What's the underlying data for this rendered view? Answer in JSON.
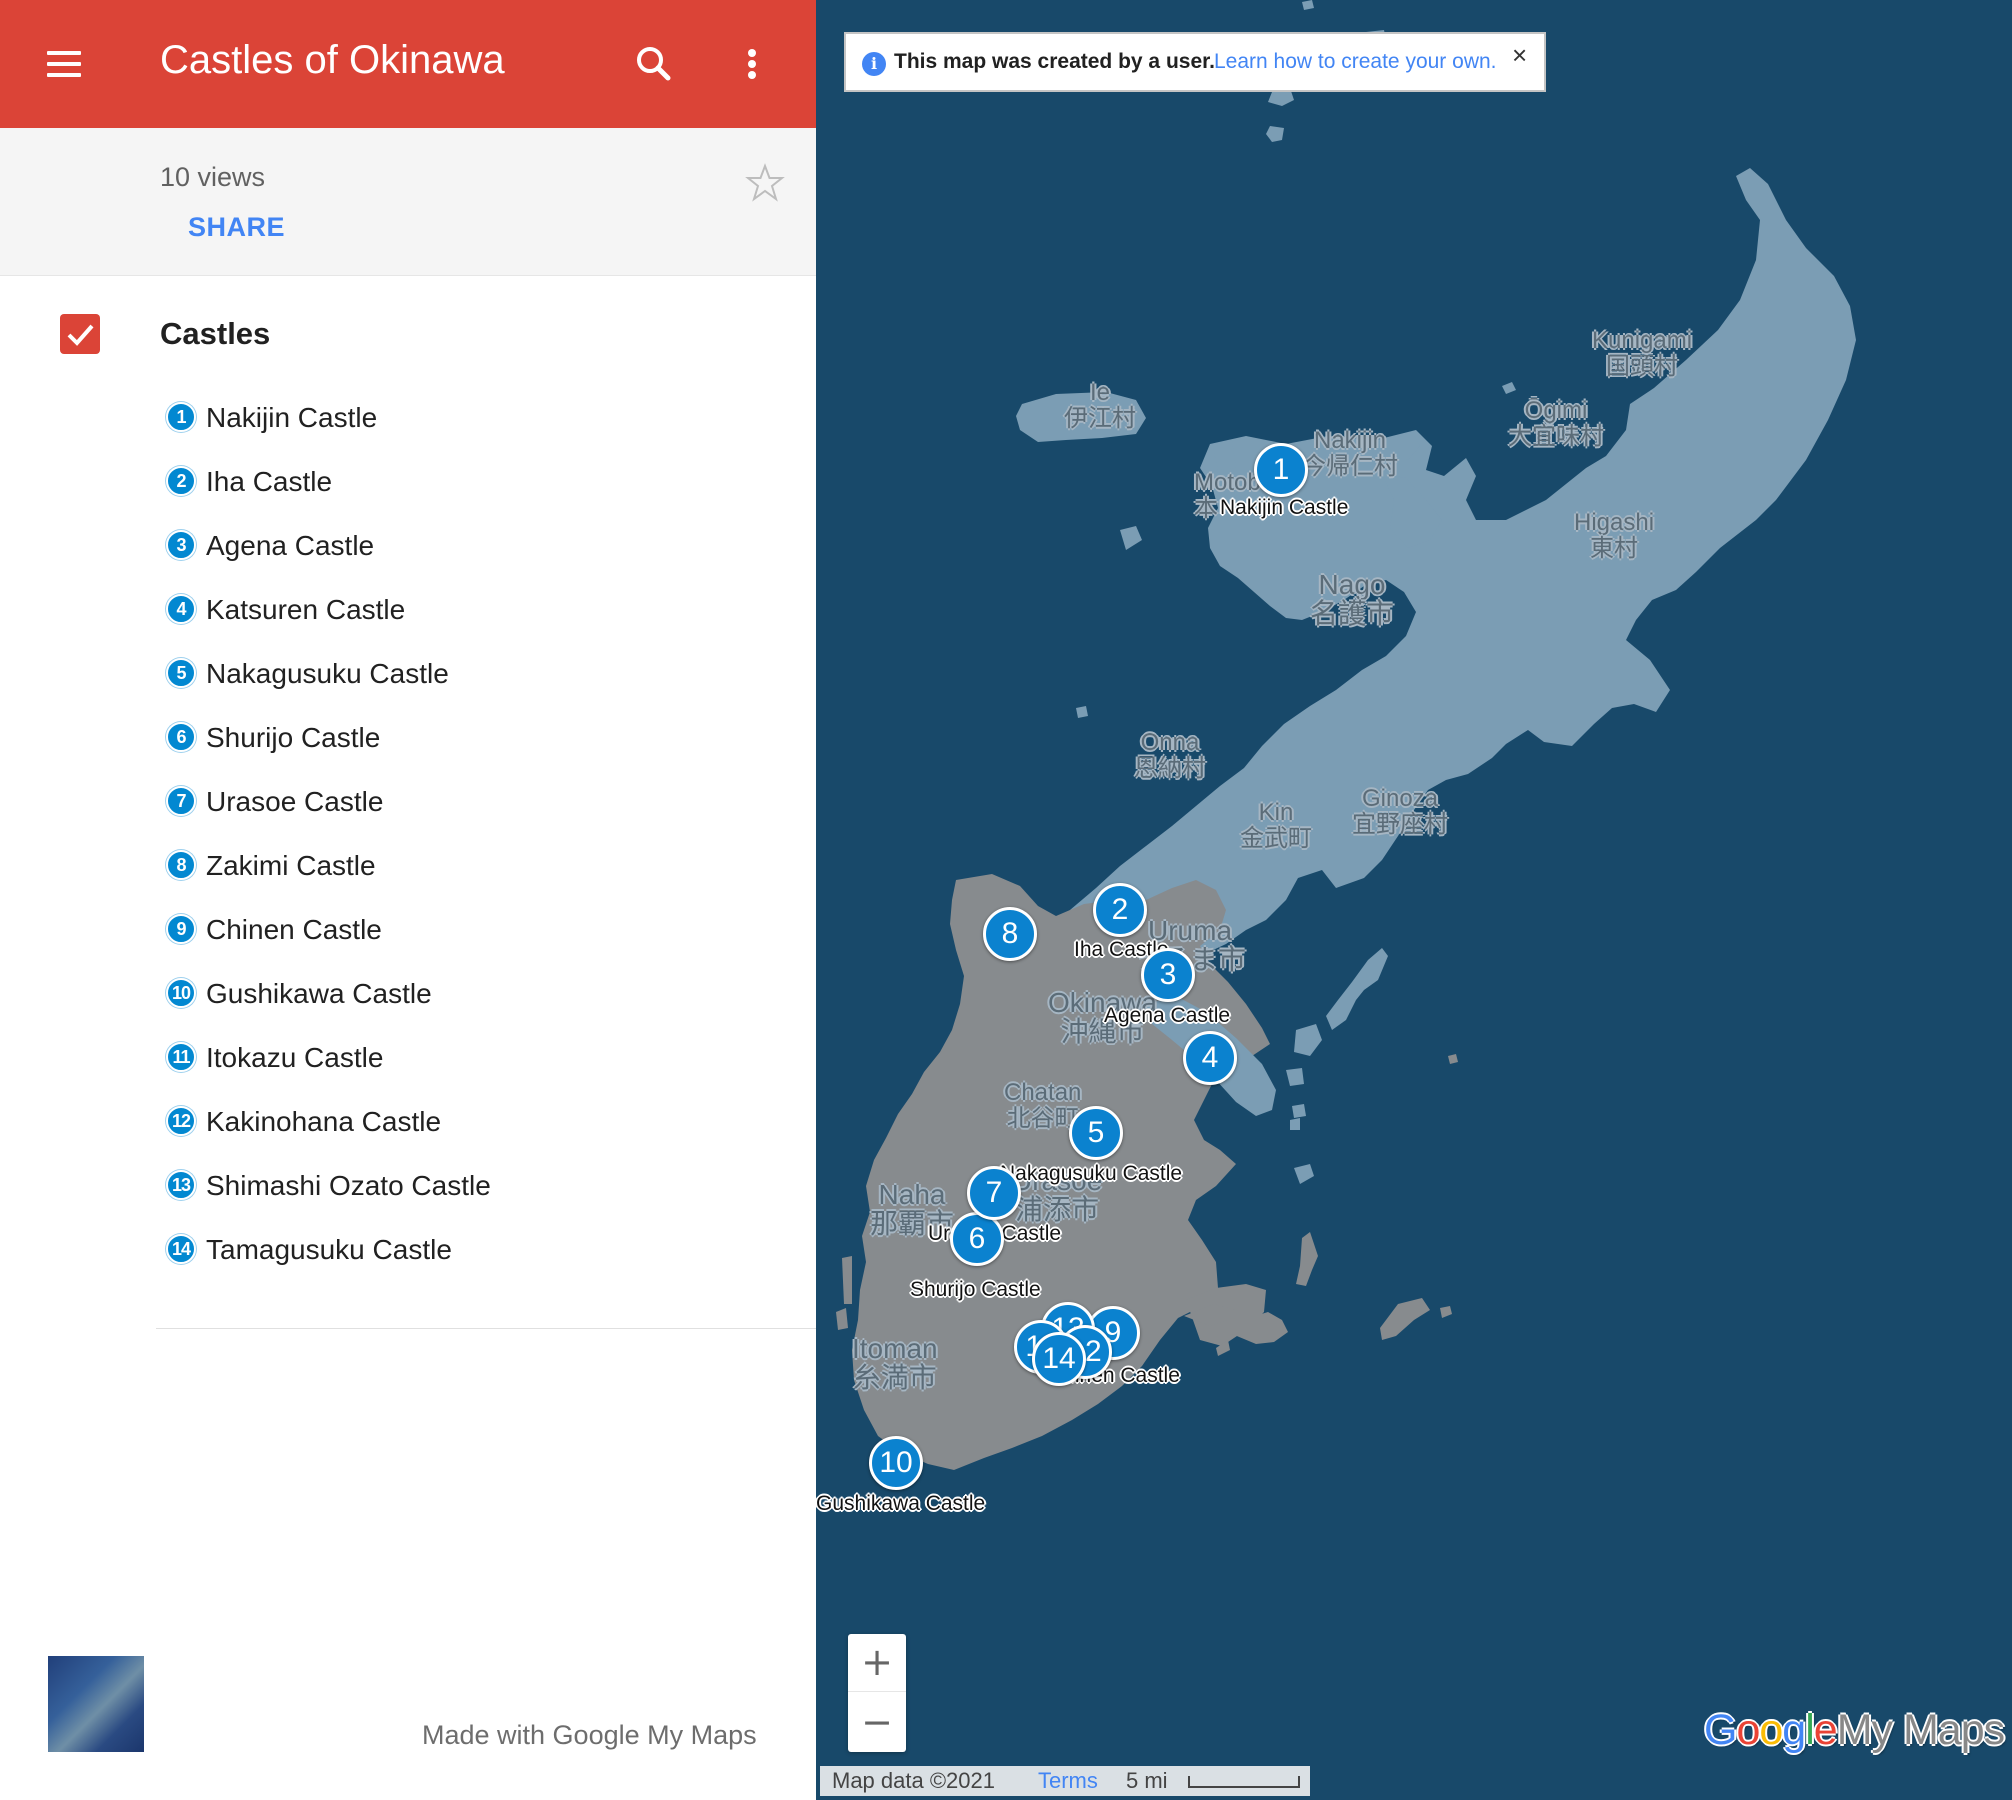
{
  "header": {
    "title": "Castles of Okinawa",
    "views": "10 views",
    "share_label": "SHARE"
  },
  "layer": {
    "title": "Castles",
    "checked": true,
    "items": [
      {
        "num": "1",
        "label": "Nakijin Castle"
      },
      {
        "num": "2",
        "label": "Iha Castle"
      },
      {
        "num": "3",
        "label": "Agena Castle"
      },
      {
        "num": "4",
        "label": "Katsuren Castle"
      },
      {
        "num": "5",
        "label": "Nakagusuku Castle"
      },
      {
        "num": "6",
        "label": "Shurijo Castle"
      },
      {
        "num": "7",
        "label": "Urasoe Castle"
      },
      {
        "num": "8",
        "label": "Zakimi Castle"
      },
      {
        "num": "9",
        "label": "Chinen Castle"
      },
      {
        "num": "10",
        "label": "Gushikawa Castle"
      },
      {
        "num": "11",
        "label": "Itokazu Castle"
      },
      {
        "num": "12",
        "label": "Kakinohana Castle"
      },
      {
        "num": "13",
        "label": "Shimashi Ozato Castle"
      },
      {
        "num": "14",
        "label": "Tamagusuku Castle"
      }
    ]
  },
  "footer_panel": {
    "made_with": "Made with Google My Maps"
  },
  "map": {
    "notice_text": "This map was created by a user.",
    "notice_link": "Learn how to create your own.",
    "zoom_in": "+",
    "zoom_out": "−",
    "map_data": "Map data ©2021",
    "terms": "Terms",
    "scale": "5 mi",
    "brand": [
      "Google",
      "My Maps"
    ],
    "places": [
      {
        "en": "Ie",
        "ja": "伊江村"
      },
      {
        "en": "Nakijin",
        "ja": "今帰仁村"
      },
      {
        "en": "Motob",
        "ja": "本"
      },
      {
        "en": "Kunigami",
        "ja": "国頭村"
      },
      {
        "en": "Ōgimi",
        "ja": "大宜味村"
      },
      {
        "en": "Higashi",
        "ja": "東村"
      },
      {
        "en": "Nago",
        "ja": "名護市"
      },
      {
        "en": "Onna",
        "ja": "恩納村"
      },
      {
        "en": "Kin",
        "ja": "金武町"
      },
      {
        "en": "Ginoza",
        "ja": "宜野座村"
      },
      {
        "en": "Uruma",
        "ja": "うるま市"
      },
      {
        "en": "Okinawa",
        "ja": "沖縄市"
      },
      {
        "en": "Chatan",
        "ja": "北谷町"
      },
      {
        "en": "Naha",
        "ja": "那覇市"
      },
      {
        "en": "Urasoe",
        "ja": "浦添市"
      },
      {
        "en": "Itoman",
        "ja": "糸満市"
      }
    ],
    "markers": [
      {
        "num": "1",
        "label": "Nakijin Castle"
      },
      {
        "num": "2",
        "label": "Iha Castle"
      },
      {
        "num": "3",
        "label": "Agena Castle"
      },
      {
        "num": "4",
        "label": ""
      },
      {
        "num": "5",
        "label": "Nakagusuku Castle"
      },
      {
        "num": "6",
        "label": "Shurijo Castle"
      },
      {
        "num": "7",
        "label": "Urasoe Castle"
      },
      {
        "num": "8",
        "label": ""
      },
      {
        "num": "9",
        "label": "Chinen Castle"
      },
      {
        "num": "10",
        "label": "Gushikawa Castle"
      },
      {
        "num": "11",
        "label": ""
      },
      {
        "num": "12",
        "label": ""
      },
      {
        "num": "13",
        "label": ""
      },
      {
        "num": "14",
        "label": ""
      }
    ]
  },
  "colors": {
    "header": "#db4437",
    "accent": "#4285f4",
    "marker": "#0b82cf",
    "sea": "#18496a",
    "land_north": "#7b9db4",
    "land_south": "#878b8e"
  }
}
